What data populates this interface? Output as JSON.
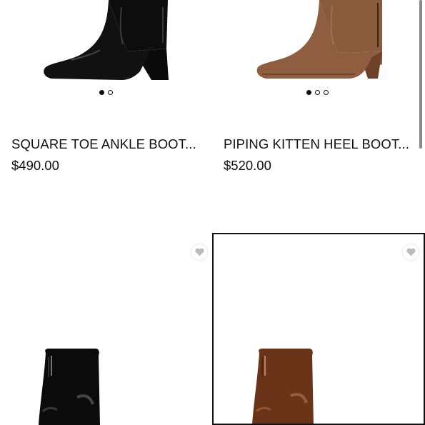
{
  "products": [
    {
      "name": "SQUARE TOE ANKLE BOOT...",
      "price": "$490.00",
      "image_icon": "black-patent-boot-image",
      "slides": 2,
      "active_slide": 1
    },
    {
      "name": "PIPING KITTEN HEEL BOOT...",
      "price": "$520.00",
      "image_icon": "brown-leather-boot-image",
      "slides": 3,
      "active_slide": 1
    },
    {
      "image_icon": "black-patent-boot-image",
      "wishlist_icon": "heart-icon"
    },
    {
      "image_icon": "brown-patent-boot-image",
      "wishlist_icon": "heart-icon",
      "selected": true
    }
  ],
  "colors": {
    "text": "#111111",
    "black_boot": "#0d0d0d",
    "brown_boot": "#8a5a3c",
    "brown_patent_boot": "#6b3418",
    "wishlist_heart": "#bbbbbb"
  }
}
